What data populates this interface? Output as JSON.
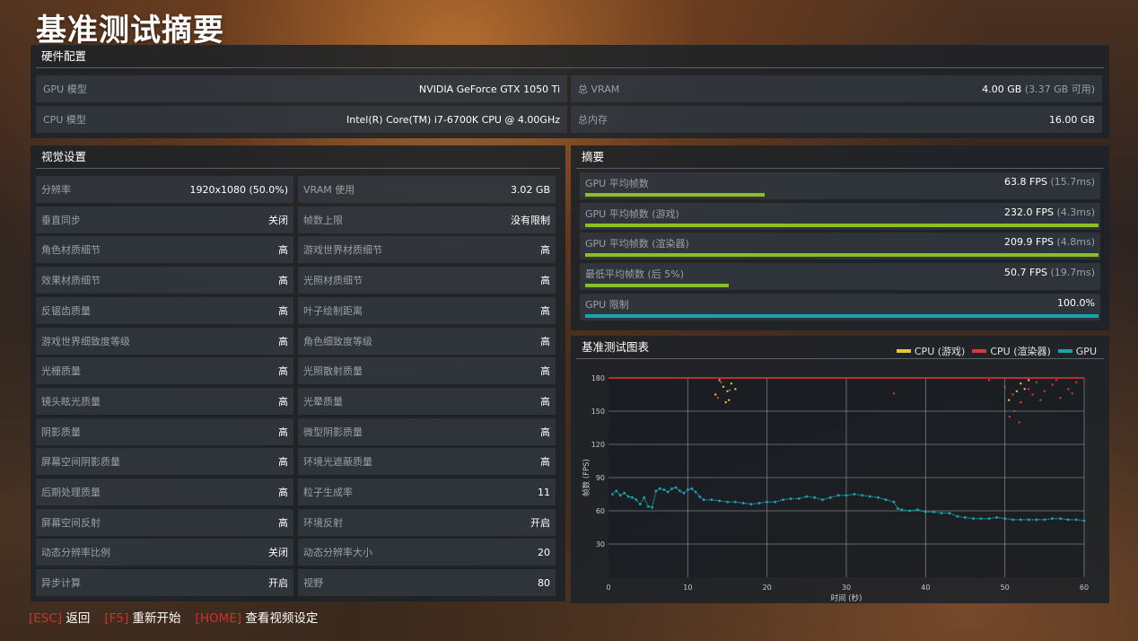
{
  "title": "基准测试摘要",
  "hardware": {
    "header": "硬件配置",
    "rows": [
      {
        "label": "GPU 模型",
        "value": "NVIDIA GeForce GTX 1050 Ti",
        "sub": ""
      },
      {
        "label": "总 VRAM",
        "value": "4.00 GB",
        "sub": "(3.37 GB 可用)"
      },
      {
        "label": "CPU 模型",
        "value": "Intel(R) Core(TM) i7-6700K CPU @ 4.00GHz",
        "sub": ""
      },
      {
        "label": "总内存",
        "value": "16.00 GB",
        "sub": ""
      }
    ]
  },
  "visual": {
    "header": "视觉设置",
    "rows": [
      [
        {
          "label": "分辨率",
          "value": "1920x1080 (50.0%)"
        },
        {
          "label": "VRAM 使用",
          "value": "3.02 GB"
        }
      ],
      [
        {
          "label": "垂直同步",
          "value": "关闭"
        },
        {
          "label": "帧数上限",
          "value": "没有限制"
        }
      ],
      [
        {
          "label": "角色材质细节",
          "value": "高"
        },
        {
          "label": "游戏世界材质细节",
          "value": "高"
        }
      ],
      [
        {
          "label": "效果材质细节",
          "value": "高"
        },
        {
          "label": "光照材质细节",
          "value": "高"
        }
      ],
      [
        {
          "label": "反锯齿质量",
          "value": "高"
        },
        {
          "label": "叶子绘制距离",
          "value": "高"
        }
      ],
      [
        {
          "label": "游戏世界细致度等级",
          "value": "高"
        },
        {
          "label": "角色细致度等级",
          "value": "高"
        }
      ],
      [
        {
          "label": "光栅质量",
          "value": "高"
        },
        {
          "label": "光照散射质量",
          "value": "高"
        }
      ],
      [
        {
          "label": "镜头眩光质量",
          "value": "高"
        },
        {
          "label": "光晕质量",
          "value": "高"
        }
      ],
      [
        {
          "label": "阴影质量",
          "value": "高"
        },
        {
          "label": "微型阴影质量",
          "value": "高"
        }
      ],
      [
        {
          "label": "屏幕空间阴影质量",
          "value": "高"
        },
        {
          "label": "环境光遮蔽质量",
          "value": "高"
        }
      ],
      [
        {
          "label": "后期处理质量",
          "value": "高"
        },
        {
          "label": "粒子生成率",
          "value": "11"
        }
      ],
      [
        {
          "label": "屏幕空间反射",
          "value": "高"
        },
        {
          "label": "环境反射",
          "value": "开启"
        }
      ],
      [
        {
          "label": "动态分辨率比例",
          "value": "关闭"
        },
        {
          "label": "动态分辨率大小",
          "value": "20"
        }
      ],
      [
        {
          "label": "异步计算",
          "value": "开启"
        },
        {
          "label": "视野",
          "value": "80"
        }
      ]
    ]
  },
  "summary": {
    "header": "摘要",
    "rows": [
      {
        "label": "GPU 平均帧数",
        "value": "63.8 FPS",
        "sub": "(15.7ms)",
        "fraction": 0.35,
        "color": "#8cbf26"
      },
      {
        "label": "GPU 平均帧数 (游戏)",
        "value": "232.0 FPS",
        "sub": "(4.3ms)",
        "fraction": 1.0,
        "color": "#8cbf26"
      },
      {
        "label": "GPU 平均帧数 (渲染器)",
        "value": "209.9 FPS",
        "sub": "(4.8ms)",
        "fraction": 1.0,
        "color": "#8cbf26"
      },
      {
        "label": "最低平均帧数 (后 5%)",
        "value": "50.7 FPS",
        "sub": "(19.7ms)",
        "fraction": 0.28,
        "color": "#8cbf26"
      },
      {
        "label": "GPU 限制",
        "value": "100.0%",
        "sub": "",
        "fraction": 1.0,
        "color": "#1aa3b3"
      }
    ]
  },
  "chart_panel": {
    "header": "基准测试图表",
    "legend": [
      {
        "name": "CPU (游戏)",
        "color": "#e8c34a"
      },
      {
        "name": "CPU (渲染器)",
        "color": "#d83a3a"
      },
      {
        "name": "GPU",
        "color": "#1aa3b3"
      }
    ]
  },
  "chart_data": {
    "type": "scatter",
    "xlabel": "时间 (秒)",
    "ylabel": "帧数 (FPS)",
    "xlim": [
      0,
      60
    ],
    "ylim": [
      0,
      180
    ],
    "xticks": [
      0,
      10,
      20,
      30,
      40,
      50,
      60
    ],
    "yticks": [
      30,
      60,
      90,
      120,
      150,
      180
    ],
    "grid": true,
    "legend_position": "top-right",
    "series": [
      {
        "name": "CPU (游戏)",
        "color": "#e8c34a",
        "points": [
          [
            14,
            178
          ],
          [
            14.5,
            172
          ],
          [
            15,
            168
          ],
          [
            15.5,
            175
          ],
          [
            15.2,
            160
          ],
          [
            16,
            170
          ],
          [
            13.5,
            165
          ],
          [
            14.8,
            158
          ],
          [
            52,
            175
          ],
          [
            51.5,
            168
          ],
          [
            50.5,
            160
          ],
          [
            52.5,
            170
          ],
          [
            53,
            178
          ]
        ]
      },
      {
        "name": "CPU (渲染器)",
        "color": "#d83a3a",
        "points": [
          [
            14.2,
            176
          ],
          [
            15.3,
            169
          ],
          [
            13.8,
            162
          ],
          [
            36,
            166
          ],
          [
            48,
            178
          ],
          [
            50,
            172
          ],
          [
            51,
            165
          ],
          [
            51.2,
            150
          ],
          [
            52,
            158
          ],
          [
            53,
            170
          ],
          [
            54,
            176
          ],
          [
            55,
            168
          ],
          [
            56,
            174
          ],
          [
            57,
            162
          ],
          [
            58,
            170
          ],
          [
            59,
            176
          ],
          [
            54.5,
            160
          ],
          [
            50.6,
            145
          ],
          [
            51.8,
            140
          ],
          [
            53.5,
            165
          ],
          [
            56.5,
            178
          ],
          [
            58.5,
            166
          ]
        ]
      },
      {
        "name": "GPU",
        "color": "#1aa3b3",
        "points": [
          [
            0.5,
            75
          ],
          [
            1,
            78
          ],
          [
            1.5,
            74
          ],
          [
            2,
            76
          ],
          [
            2.5,
            73
          ],
          [
            3,
            72
          ],
          [
            3.5,
            70
          ],
          [
            4,
            66
          ],
          [
            4.5,
            72
          ],
          [
            5,
            64
          ],
          [
            5.5,
            63
          ],
          [
            6,
            78
          ],
          [
            6.5,
            80
          ],
          [
            7,
            79
          ],
          [
            7.5,
            77
          ],
          [
            8,
            80
          ],
          [
            8.5,
            81
          ],
          [
            9,
            78
          ],
          [
            9.5,
            76
          ],
          [
            10,
            79
          ],
          [
            10.5,
            80
          ],
          [
            11,
            77
          ],
          [
            11.5,
            73
          ],
          [
            12,
            70
          ],
          [
            13,
            70
          ],
          [
            14,
            69
          ],
          [
            15,
            68
          ],
          [
            16,
            68
          ],
          [
            17,
            67
          ],
          [
            18,
            66
          ],
          [
            19,
            67
          ],
          [
            20,
            68
          ],
          [
            21,
            68
          ],
          [
            22,
            70
          ],
          [
            23,
            71
          ],
          [
            24,
            71
          ],
          [
            25,
            73
          ],
          [
            26,
            72
          ],
          [
            27,
            70
          ],
          [
            28,
            72
          ],
          [
            29,
            74
          ],
          [
            30,
            74
          ],
          [
            31,
            75
          ],
          [
            32,
            74
          ],
          [
            33,
            73
          ],
          [
            34,
            72
          ],
          [
            35,
            70
          ],
          [
            36,
            68
          ],
          [
            36.5,
            62
          ],
          [
            37,
            61
          ],
          [
            38,
            60
          ],
          [
            39,
            61
          ],
          [
            40,
            59
          ],
          [
            41,
            59
          ],
          [
            42,
            58
          ],
          [
            43,
            58
          ],
          [
            44,
            55
          ],
          [
            45,
            54
          ],
          [
            46,
            53
          ],
          [
            47,
            53
          ],
          [
            48,
            53
          ],
          [
            49,
            54
          ],
          [
            50,
            53
          ],
          [
            51,
            52
          ],
          [
            52,
            52
          ],
          [
            53,
            52
          ],
          [
            54,
            52
          ],
          [
            55,
            52
          ],
          [
            56,
            53
          ],
          [
            57,
            53
          ],
          [
            58,
            52
          ],
          [
            59,
            52
          ],
          [
            60,
            51
          ]
        ]
      }
    ]
  },
  "footer": [
    {
      "key": "[ESC]",
      "label": "返回"
    },
    {
      "key": "[F5]",
      "label": "重新开始"
    },
    {
      "key": "[HOME]",
      "label": "查看视频设定"
    }
  ]
}
